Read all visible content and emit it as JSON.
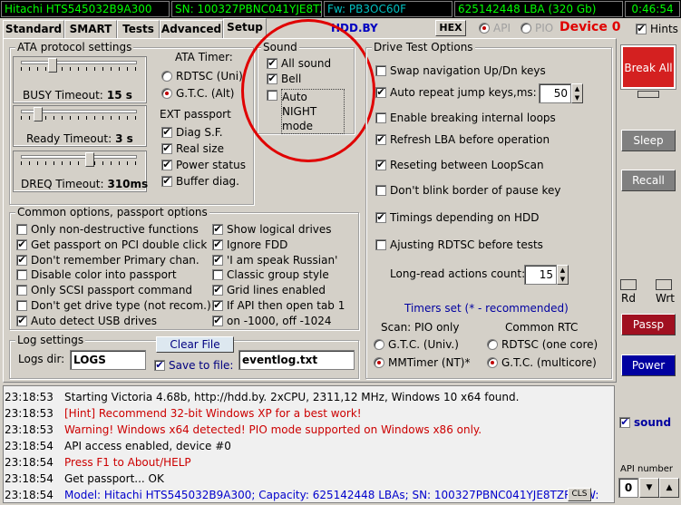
{
  "topbar": {
    "model": "Hitachi HTS545032B9A300",
    "serial": "SN: 100327PBNC041YJE8TZR",
    "firmware": "Fw: PB3OC60F",
    "lba": "625142448 LBA (320 Gb)",
    "time": "0:46:54"
  },
  "tabs": [
    "Standard",
    "SMART",
    "Tests",
    "Advanced",
    "Setup"
  ],
  "header": {
    "link": "HDD.BY",
    "hex_label": "HEX",
    "api_label": "API",
    "pio_label": "PIO",
    "device_label": "Device 0",
    "hints_label": "Hints"
  },
  "ata": {
    "title": "ATA protocol settings",
    "busy_label": "BUSY Timeout:",
    "busy_value": "15 s",
    "busy_level": 0.25,
    "ready_label": "Ready Timeout:",
    "ready_value": "3 s",
    "ready_level": 0.12,
    "dreq_label": "DREQ Timeout:",
    "dreq_value": "310ms",
    "dreq_level": 0.6
  },
  "timer": {
    "title": "ATA Timer:",
    "rdtsc": "RDTSC (Uni)",
    "gtc": "G.T.C. (Alt)"
  },
  "passport": {
    "title": "EXT passport",
    "items": [
      "Diag S.F.",
      "Real size",
      "Power status",
      "Buffer diag."
    ]
  },
  "sound": {
    "title": "Sound",
    "all": "All sound",
    "bell": "Bell",
    "night": "Auto NIGHT mode"
  },
  "drive_test": {
    "title": "Drive Test Options",
    "swap": "Swap navigation Up/Dn keys",
    "autorepeat": "Auto repeat jump keys,ms:",
    "autorepeat_value": "50",
    "breaking": "Enable breaking internal loops",
    "refresh": "Refresh LBA before operation",
    "reseting": "Reseting between LoopScan",
    "dontblink": "Don't blink border of pause key",
    "timings": "Timings depending on HDD",
    "ajusting": "Ajusting RDTSC before tests",
    "longread_label": "Long-read actions count:",
    "longread_value": "15",
    "timers_title": "Timers set  (* - recommended)",
    "scan_title": "Scan: PIO only",
    "common_title": "Common RTC",
    "scan_gtc": "G.T.C. (Univ.)",
    "scan_mm": "MMTimer (NT)*",
    "rtc_rdtsc": "RDTSC (one core)",
    "rtc_gtc": "G.T.C.  (multicore)"
  },
  "common": {
    "title": "Common options, passport options",
    "left": [
      {
        "label": "Only non-destructive functions",
        "checked": false
      },
      {
        "label": "Get passport on PCI double click",
        "checked": true
      },
      {
        "label": "Don't remember Primary chan.",
        "checked": true
      },
      {
        "label": "Disable color into passport",
        "checked": false
      },
      {
        "label": "Only SCSI passport command",
        "checked": false
      },
      {
        "label": "Don't get drive type (not recom.)",
        "checked": false
      },
      {
        "label": "Auto detect USB drives",
        "checked": true
      }
    ],
    "right": [
      {
        "label": "Show logical drives",
        "checked": true
      },
      {
        "label": "Ignore FDD",
        "checked": true
      },
      {
        "label": "'I am speak Russian'",
        "checked": true
      },
      {
        "label": "Classic group style",
        "checked": false
      },
      {
        "label": "Grid lines enabled",
        "checked": true
      },
      {
        "label": "If API then open tab 1",
        "checked": true
      },
      {
        "label": "on -1000, off -1024",
        "checked": true
      }
    ]
  },
  "logsettings": {
    "title": "Log settings",
    "dir_label": "Logs dir:",
    "dir_value": "LOGS",
    "clear_label": "Clear File",
    "save_label": "Save to file:",
    "file_value": "eventlog.txt"
  },
  "log": [
    {
      "time": "23:18:53",
      "text": "Starting Victoria 4.68b, http://hdd.by. 2xCPU, 2311,12 MHz, Windows 10 x64 found.",
      "color": "#000000"
    },
    {
      "time": "23:18:53",
      "text": "[Hint] Recommend 32-bit Windows XP for a best work!",
      "color": "#cc0000"
    },
    {
      "time": "23:18:53",
      "text": "Warning! Windows x64 detected! PIO mode supported on Windows x86 only.",
      "color": "#cc0000"
    },
    {
      "time": "23:18:54",
      "text": "API access enabled, device #0",
      "color": "#000000"
    },
    {
      "time": "23:18:54",
      "text": "Press F1 to About/HELP",
      "color": "#cc0000"
    },
    {
      "time": "23:18:54",
      "text": "Get passport... OK",
      "color": "#000000"
    },
    {
      "time": "23:18:54",
      "text": "Model: Hitachi HTS545032B9A300; Capacity: 625142448 LBAs; SN: 100327PBNC041YJE8TZR; FW:",
      "color": "#0000cc"
    }
  ],
  "cls_label": "CLS",
  "side": {
    "break_all": "Break All",
    "sleep": "Sleep",
    "recall": "Recall",
    "rd": "Rd",
    "wrt": "Wrt",
    "passp": "Passp",
    "power": "Power",
    "sound": "sound",
    "api_number_label": "API number",
    "api_number_value": "0"
  },
  "colors": {
    "accent_red": "#d42020",
    "passp": "#a01020",
    "power": "#0000a0",
    "log_blue": "#0000cc",
    "status_green": "#00ff00"
  }
}
